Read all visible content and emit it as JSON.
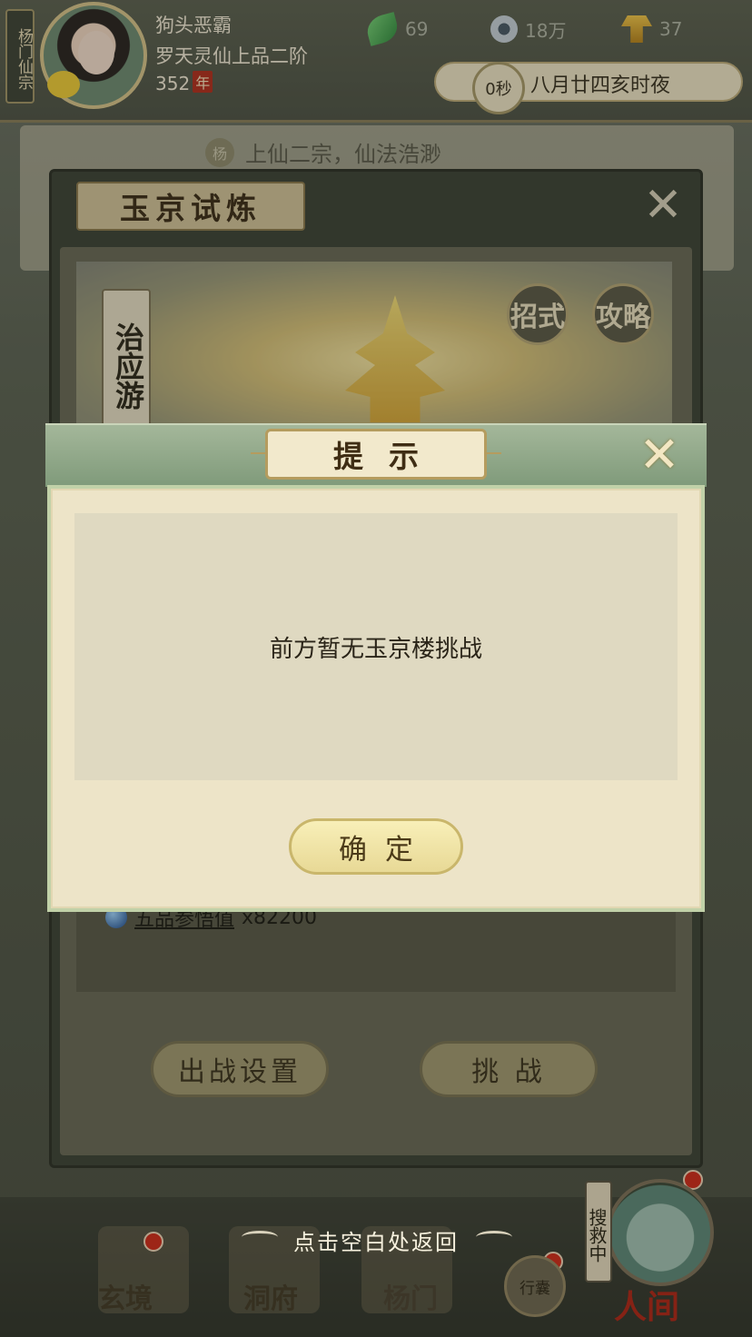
{
  "topbar": {
    "sect_label": "杨门仙宗",
    "player_name": "狗头恶霸",
    "player_rank": "罗天灵仙上品二阶",
    "player_years": "352",
    "years_badge": "年",
    "resources": [
      {
        "icon": "leaf-icon",
        "value": "69"
      },
      {
        "icon": "coin-icon",
        "value": "18万"
      },
      {
        "icon": "gold-icon",
        "value": "37"
      }
    ],
    "time_seconds": "0秒",
    "date_text": "八月廿四亥时夜"
  },
  "background": {
    "chat_tag": "杨",
    "chat_text": "上仙二宗，仙法浩渺"
  },
  "trial_dialog": {
    "title": "玉京试炼",
    "close_icon": "close-icon",
    "boss_name": "治应游",
    "moves_label": "招式",
    "guide_label": "攻略",
    "reward_text": "五品参悟值",
    "reward_amount": "x82200",
    "battle_setup_label": "出战设置",
    "challenge_label": "挑 战"
  },
  "tip_dialog": {
    "title": "提示",
    "message": "前方暂无玉京楼挑战",
    "confirm_label": "确定",
    "close_icon": "close-icon"
  },
  "hint": "点击空白处返回",
  "bottom_nav": {
    "items": [
      {
        "label": "玄境"
      },
      {
        "label": "洞府"
      },
      {
        "label": "杨门"
      },
      {
        "label": "行囊"
      },
      {
        "label": "人间"
      }
    ],
    "search_tag": "搜救中"
  },
  "colors": {
    "dialog_body": "#ede4c8",
    "dialog_header": "#8fa88a",
    "confirm_button": "#f3e7a8",
    "badge_red": "#d22b1b"
  }
}
